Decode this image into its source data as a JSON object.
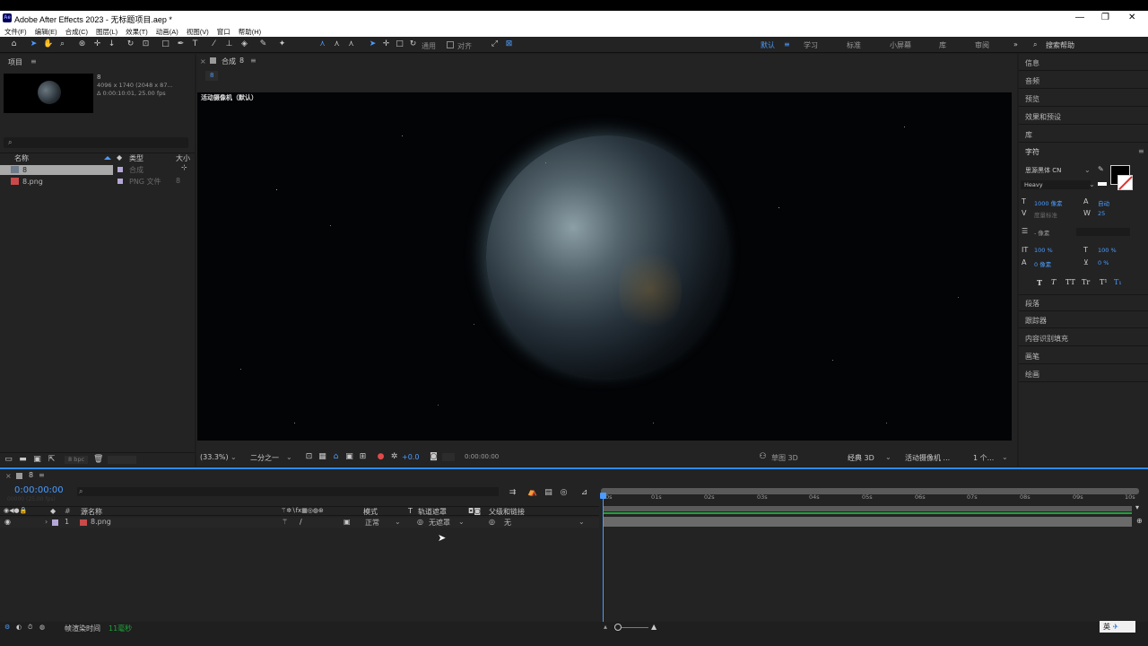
{
  "window": {
    "title": "Adobe After Effects 2023 - 无标题项目.aep *",
    "app_badge": "Ae",
    "controls": [
      "—",
      "❐",
      "✕"
    ]
  },
  "menu": [
    "文件(F)",
    "编辑(E)",
    "合成(C)",
    "图层(L)",
    "效果(T)",
    "动画(A)",
    "视图(V)",
    "窗口",
    "帮助(H)"
  ],
  "toolbar": {
    "align_label": "对齐",
    "universal_label": "通用",
    "workspaces": [
      "默认",
      "学习",
      "标准",
      "小屏幕",
      "库",
      "审阅"
    ],
    "active_workspace": "默认",
    "search_placeholder": "搜索帮助"
  },
  "project": {
    "title": "项目",
    "item_name": "8",
    "item_info1": "4096 x 1740  (2048 x 87...",
    "item_info2": "Δ 0:00:10:01, 25.00 fps",
    "search_placeholder": "",
    "columns": [
      "名称",
      "类型",
      "大小"
    ],
    "items": [
      {
        "name": "8",
        "type": "合成",
        "size": ""
      },
      {
        "name": "8.png",
        "type": "PNG 文件",
        "size": "8"
      }
    ],
    "bpc": "8 bpc"
  },
  "comp": {
    "tab_label": "合成",
    "tab_name": "8",
    "sub_tab": "8",
    "camera_label": "活动摄像机（默认）",
    "zoom": "(33.3%)",
    "resolution": "二分之一",
    "exposure": "+0.0",
    "timecode": "0:00:00:00",
    "renderer": "草图 3D",
    "renderer_classic": "经典 3D",
    "view_camera": "活动摄像机 ...",
    "views": "1 个..."
  },
  "right": {
    "panels": [
      "信息",
      "音频",
      "预览",
      "效果和预设",
      "库"
    ],
    "char_title": "字符",
    "font": "思源黑体 CN",
    "weight": "Heavy",
    "font_size": "1000 像素",
    "leading": "自动",
    "kerning": "度量标准",
    "tracking": "25",
    "stroke": "- 像素",
    "vscale": "100 %",
    "hscale": "100 %",
    "baseline": "0 像素",
    "tsume": "0 %",
    "styles": [
      "T",
      "T",
      "TT",
      "Tr",
      "T¹",
      "T₁"
    ],
    "lower_panels": [
      "段落",
      "跟踪器",
      "内容识别填充",
      "画笔",
      "绘画"
    ]
  },
  "timeline": {
    "comp_name": "8",
    "timecode": "0:00:00:00",
    "timecode_sub": "00000 (25.00 fps)",
    "col_name": "源名称",
    "col_mode": "模式",
    "col_t": "T",
    "col_track": "轨道遮罩",
    "col_parent": "父级和链接",
    "layer_num": "1",
    "layer_name": "8.png",
    "layer_mode": "正常",
    "layer_track": "无遮罩",
    "layer_parent": "无",
    "ruler": [
      "0s",
      "01s",
      "02s",
      "03s",
      "04s",
      "05s",
      "06s",
      "07s",
      "08s",
      "09s",
      "10s"
    ],
    "render_label": "帧渲染时间",
    "render_value": "11毫秒",
    "ime": "英"
  },
  "colors": {
    "accent": "#4b9cff",
    "label_purple": "#b4a7d6",
    "green_bar": "#1fa33a"
  }
}
